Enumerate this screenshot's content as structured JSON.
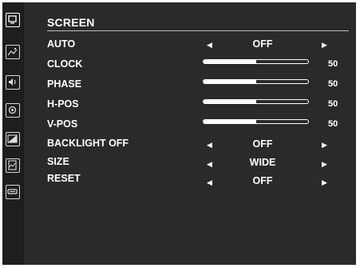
{
  "menu": {
    "title": "SCREEN",
    "rows": {
      "auto": {
        "label": "AUTO",
        "value": "OFF"
      },
      "clock": {
        "label": "CLOCK",
        "value": "50",
        "level": 0.5
      },
      "phase": {
        "label": "PHASE",
        "value": "50",
        "level": 0.5
      },
      "hpos": {
        "label": "H-POS",
        "value": "50",
        "level": 0.5
      },
      "vpos": {
        "label": "V-POS",
        "value": "50",
        "level": 0.5
      },
      "backlight": {
        "label": "BACKLIGHT OFF",
        "value": "OFF"
      },
      "size": {
        "label": "SIZE",
        "value": "WIDE"
      },
      "reset": {
        "label": "RESET",
        "value": "OFF"
      }
    },
    "arrows": {
      "left": "◀",
      "right": "▶"
    }
  },
  "sidebar": {
    "icons": [
      "screen-icon",
      "picture-icon",
      "sound-icon",
      "settings-icon",
      "color-icon",
      "image-icon",
      "input-icon"
    ],
    "active": "screen-icon"
  }
}
